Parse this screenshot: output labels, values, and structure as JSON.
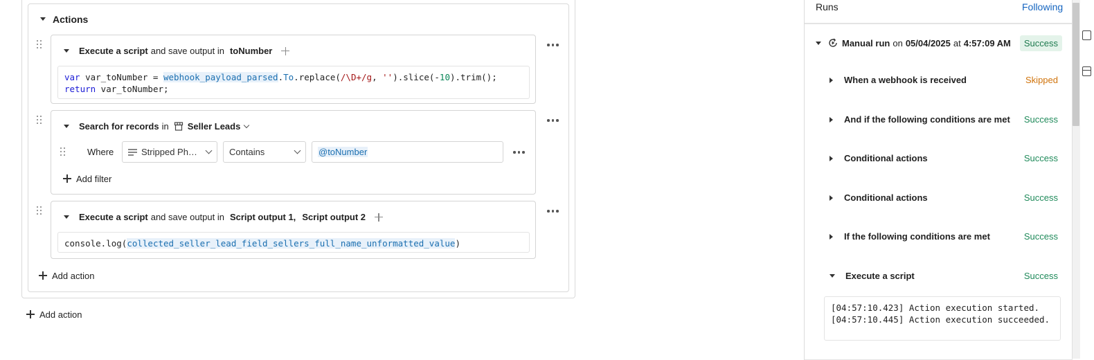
{
  "actions_group": {
    "title": "Actions",
    "add_action_inner": "Add action",
    "add_action_outer": "Add action"
  },
  "step1": {
    "verb": "Execute a script",
    "mid": "and save output in",
    "output": "toNumber",
    "code": {
      "l1_kw": "var",
      "l1_var": " var_toNumber = ",
      "l1_tok": "webhook_payload_parsed",
      "l1_dot": ".",
      "l1_prop": "To",
      "l1_call": ".replace(",
      "l1_regex": "/\\D+/g",
      "l1_comma": ", ",
      "l1_str": "''",
      "l1_slice": ").slice(-",
      "l1_num": "10",
      "l1_end": ").trim();",
      "l2_kw": "return",
      "l2_rest": " var_toNumber;"
    }
  },
  "step2": {
    "verb": "Search for records",
    "mid": "in",
    "table": "Seller Leads",
    "where_label": "Where",
    "field": "Stripped Ph…",
    "operator": "Contains",
    "value_token": "@toNumber",
    "add_filter": "Add filter"
  },
  "step3": {
    "verb": "Execute a script",
    "mid": "and save output in",
    "output1": "Script output 1,",
    "output2": "Script output 2",
    "code": {
      "pre": "console.log(",
      "tok": "collected_seller_lead_field_sellers_full_name_unformatted_value",
      "post": ")"
    }
  },
  "runs": {
    "title": "Runs",
    "following": "Following",
    "run": {
      "label_bold": "Manual run",
      "on": "on",
      "date": "05/04/2025",
      "at": "at",
      "time": "4:57:09 AM",
      "status": "Success"
    },
    "steps": [
      {
        "label": "When a webhook is received",
        "status": "Skipped"
      },
      {
        "label": "And if the following conditions are met",
        "status": "Success"
      },
      {
        "label": "Conditional actions",
        "status": "Success"
      },
      {
        "label": "Conditional actions",
        "status": "Success"
      },
      {
        "label": "If the following conditions are met",
        "status": "Success"
      },
      {
        "label": "Execute a script",
        "status": "Success"
      }
    ],
    "log": "[04:57:10.423] Action execution started.\n[04:57:10.445] Action execution succeeded."
  },
  "colors": {
    "success": "#1f8a5a",
    "skipped": "#d0730b",
    "link": "#1565c0",
    "token_bg": "#e8f1fa"
  }
}
